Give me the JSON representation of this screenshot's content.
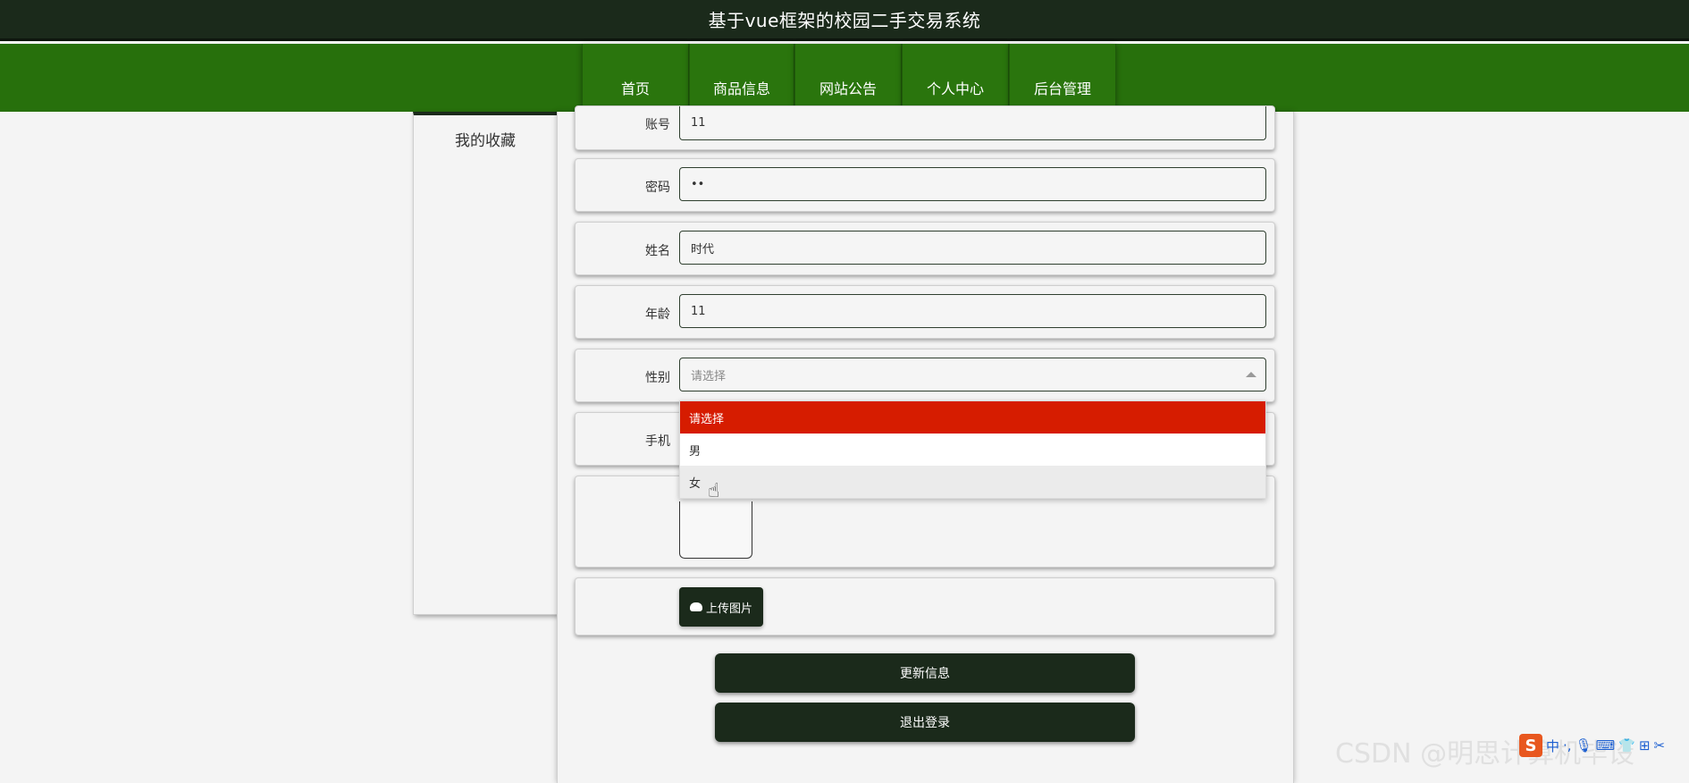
{
  "header": {
    "title": "基于vue框架的校园二手交易系统"
  },
  "nav": {
    "items": [
      {
        "label": "首页"
      },
      {
        "label": "商品信息"
      },
      {
        "label": "网站公告"
      },
      {
        "label": "个人中心"
      },
      {
        "label": "后台管理"
      }
    ]
  },
  "sidebar": {
    "items": [
      {
        "label": "我的收藏"
      }
    ]
  },
  "form": {
    "account": {
      "label": "账号",
      "value": "11"
    },
    "password": {
      "label": "密码",
      "value": "••"
    },
    "name": {
      "label": "姓名",
      "value": "时代"
    },
    "age": {
      "label": "年龄",
      "value": "11"
    },
    "gender": {
      "label": "性别",
      "placeholder": "请选择"
    },
    "phone": {
      "label": "手机"
    }
  },
  "gender_dropdown": {
    "options": [
      {
        "label": "请选择",
        "state": "selected"
      },
      {
        "label": "男",
        "state": "normal"
      },
      {
        "label": "女",
        "state": "hover"
      }
    ]
  },
  "upload": {
    "label": "上传图片",
    "icon": "cloud-upload-icon"
  },
  "actions": {
    "update_label": "更新信息",
    "logout_label": "退出登录"
  },
  "colors": {
    "header_bg": "#1b2a1b",
    "nav_bg": "#27700c",
    "selected_option": "#d61c00",
    "button_bg": "#1b2a1b"
  },
  "overlay": {
    "watermark": "CSDN @明思计算机毕设",
    "ime": [
      "S",
      "中",
      "·,",
      "🎙",
      "⌨",
      "👕",
      "⊞",
      "✂"
    ]
  }
}
